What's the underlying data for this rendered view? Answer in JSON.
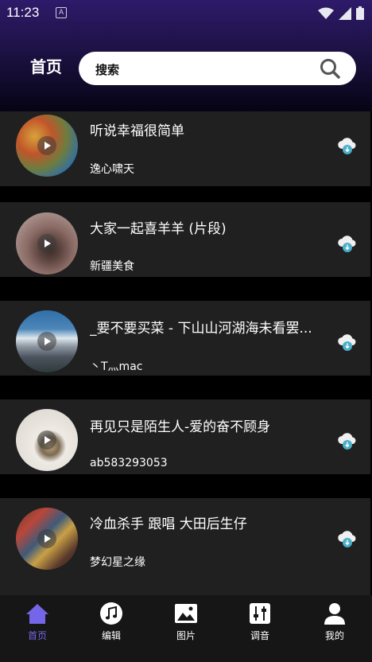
{
  "status_bar": {
    "time": "11:23",
    "notification": "A"
  },
  "header": {
    "title": "首页",
    "search_placeholder": "搜索"
  },
  "songs": [
    {
      "title": "听说幸福很简单",
      "artist": "逸心啸天"
    },
    {
      "title": "大家一起喜羊羊 (片段)",
      "artist": "新疆美食"
    },
    {
      "title": "_要不要买菜 - 下山山河湖海未看罢...",
      "artist": "丶T灬mac"
    },
    {
      "title": "再见只是陌生人-爱的奋不顾身",
      "artist": "ab583293053"
    },
    {
      "title": "冷血杀手 跟唱 大田后生仔",
      "artist": "梦幻星之缘"
    }
  ],
  "tabs": [
    {
      "label": "首页",
      "icon": "home-icon",
      "active": true
    },
    {
      "label": "编辑",
      "icon": "music-note-icon",
      "active": false
    },
    {
      "label": "图片",
      "icon": "image-icon",
      "active": false
    },
    {
      "label": "调音",
      "icon": "equalizer-icon",
      "active": false
    },
    {
      "label": "我的",
      "icon": "user-icon",
      "active": false
    }
  ],
  "colors": {
    "accent": "#7565e8",
    "card": "#202020",
    "header_top": "#2e1a6a",
    "download": "#4aaec9"
  }
}
